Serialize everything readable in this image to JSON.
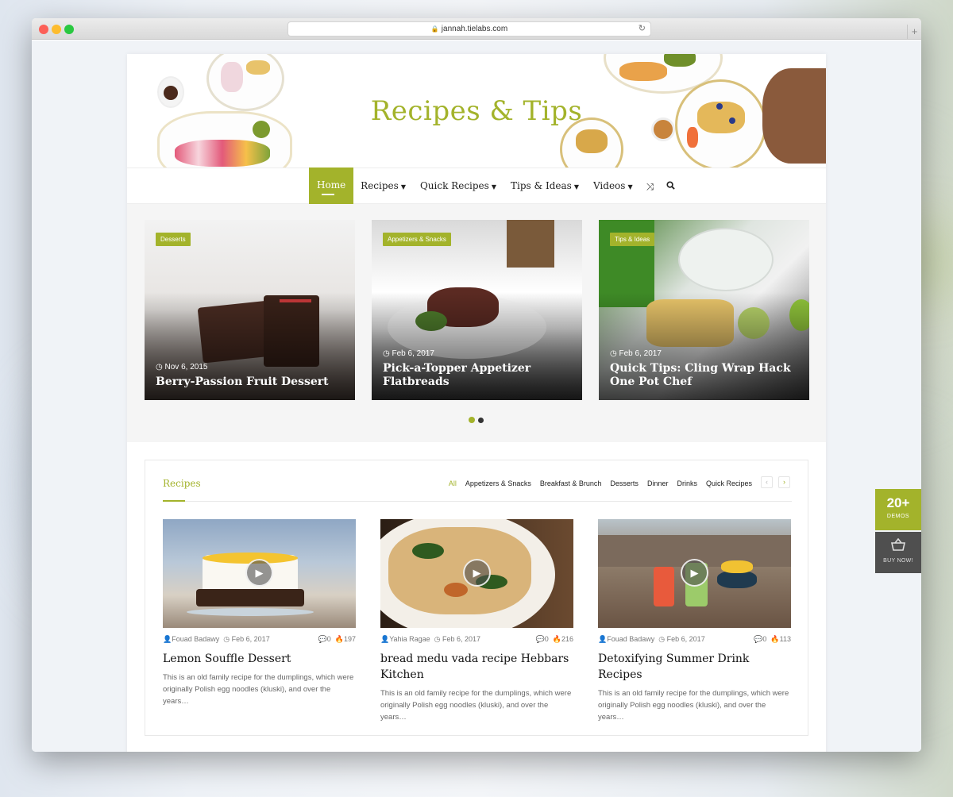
{
  "browser": {
    "url": "jannah.tielabs.com"
  },
  "site": {
    "title": "Recipes & Tips"
  },
  "nav": {
    "items": [
      {
        "label": "Home",
        "active": true
      },
      {
        "label": "Recipes",
        "active": false
      },
      {
        "label": "Quick Recipes",
        "active": false
      },
      {
        "label": "Tips & Ideas",
        "active": false
      },
      {
        "label": "Videos",
        "active": false
      }
    ],
    "icons": [
      "shuffle-icon",
      "search-icon"
    ]
  },
  "slider": {
    "slides": [
      {
        "category": "Desserts",
        "date": "Nov 6, 2015",
        "title": "Berry-Passion Fruit Dessert"
      },
      {
        "category": "Appetizers & Snacks",
        "date": "Feb 6, 2017",
        "title": "Pick-a-Topper Appetizer Flatbreads"
      },
      {
        "category": "Tips & Ideas",
        "date": "Feb 6, 2017",
        "title": "Quick Tips: Cling Wrap Hack One Pot Chef"
      }
    ],
    "current_page": 1,
    "page_count": 2
  },
  "recipes_block": {
    "title": "Recipes",
    "tabs": [
      "All",
      "Appetizers & Snacks",
      "Breakfast & Brunch",
      "Desserts",
      "Dinner",
      "Drinks",
      "Quick Recipes"
    ],
    "active_tab": "All",
    "cards": [
      {
        "author": "Fouad Badawy",
        "date": "Feb 6, 2017",
        "comments": "0",
        "views": "197",
        "title": "Lemon Souffle Dessert",
        "excerpt": "This is an old family recipe for the dumplings, which were originally Polish egg noodles (kluski), and over the years…"
      },
      {
        "author": "Yahia Ragae",
        "date": "Feb 6, 2017",
        "comments": "0",
        "views": "216",
        "title": "bread medu vada recipe Hebbars Kitchen",
        "excerpt": "This is an old family recipe for the dumplings, which were originally Polish egg noodles (kluski), and over the years…"
      },
      {
        "author": "Fouad Badawy",
        "date": "Feb 6, 2017",
        "comments": "0",
        "views": "113",
        "title": "Detoxifying Summer Drink Recipes",
        "excerpt": "This is an old family recipe for the dumplings, which were originally Polish egg noodles (kluski), and over the years…"
      }
    ]
  },
  "side": {
    "demos_count": "20+",
    "demos_label": "DEMOS",
    "buy_label": "BUY NOW!"
  },
  "colors": {
    "accent": "#a3b32b",
    "text": "#222222"
  }
}
